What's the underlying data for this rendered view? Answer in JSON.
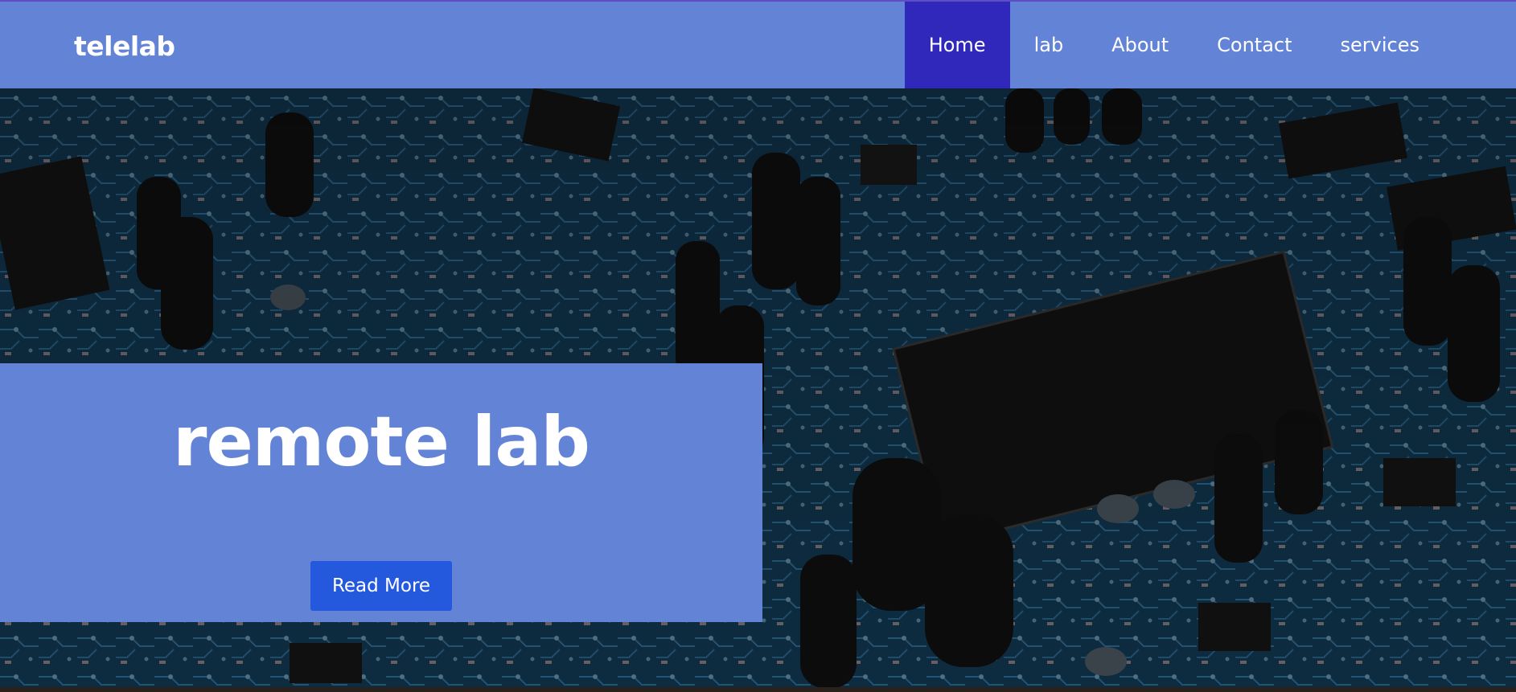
{
  "header": {
    "brand": "telelab",
    "nav": [
      {
        "label": "Home",
        "active": true
      },
      {
        "label": "lab",
        "active": false
      },
      {
        "label": "About",
        "active": false
      },
      {
        "label": "Contact",
        "active": false
      },
      {
        "label": "services",
        "active": false
      }
    ]
  },
  "hero": {
    "title": "remote lab",
    "button_label": "Read More",
    "background": "circuit-board-image"
  },
  "colors": {
    "header_bg": "#6384d6",
    "nav_active_bg": "#2f28bb",
    "panel_bg": "#6384d6",
    "button_bg": "#2559dd",
    "text": "#ffffff"
  }
}
